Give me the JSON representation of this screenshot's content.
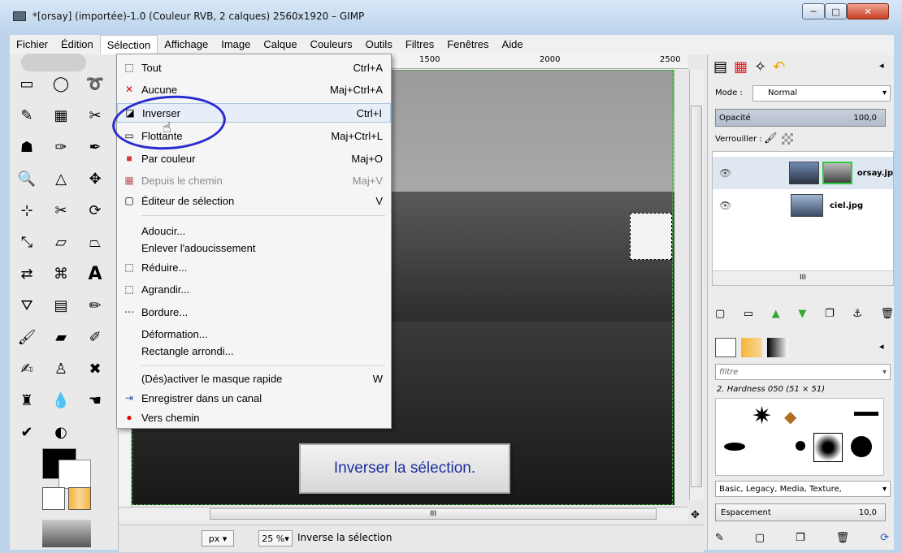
{
  "window": {
    "title": "*[orsay] (importée)-1.0 (Couleur RVB, 2 calques) 2560x1920 – GIMP",
    "buttons": {
      "minimize": "─",
      "maximize": "□",
      "close": "✕"
    }
  },
  "menubar": [
    "Fichier",
    "Édition",
    "Sélection",
    "Affichage",
    "Image",
    "Calque",
    "Couleurs",
    "Outils",
    "Filtres",
    "Fenêtres",
    "Aide"
  ],
  "dropdown": [
    {
      "label": "Tout",
      "shortcut": "Ctrl+A",
      "icon": "⬚"
    },
    {
      "label": "Aucune",
      "shortcut": "Maj+Ctrl+A",
      "icon": "✕"
    },
    {
      "label": "Inverser",
      "shortcut": "Ctrl+I",
      "icon": "◪"
    },
    {
      "label": "Flottante",
      "shortcut": "Maj+Ctrl+L",
      "icon": "▭"
    },
    {
      "label": "Par couleur",
      "shortcut": "Maj+O",
      "icon": "■"
    },
    {
      "label": "Depuis le chemin",
      "shortcut": "Maj+V",
      "icon": "▦"
    },
    {
      "label": "Éditeur de sélection",
      "shortcut": "V",
      "icon": "▢"
    },
    {
      "label": "Adoucir...",
      "shortcut": "",
      "icon": ""
    },
    {
      "label": "Enlever l'adoucissement",
      "shortcut": "",
      "icon": ""
    },
    {
      "label": "Réduire...",
      "shortcut": "",
      "icon": "⬚"
    },
    {
      "label": "Agrandir...",
      "shortcut": "",
      "icon": "⬚"
    },
    {
      "label": "Bordure...",
      "shortcut": "",
      "icon": "⋯"
    },
    {
      "label": "Déformation...",
      "shortcut": "",
      "icon": ""
    },
    {
      "label": "Rectangle arrondi...",
      "shortcut": "",
      "icon": ""
    },
    {
      "label": "(Dés)activer le masque rapide",
      "shortcut": "W",
      "icon": ""
    },
    {
      "label": "Enregistrer dans un canal",
      "shortcut": "",
      "icon": "⇥"
    },
    {
      "label": "Vers chemin",
      "shortcut": "",
      "icon": "●"
    }
  ],
  "ruler": {
    "t1500": "1500",
    "t2000": "2000",
    "t2500": "2500"
  },
  "hint": "Inverser la sélection.",
  "status": {
    "unit": "px",
    "zoom": "25 %",
    "message": "Inverse la sélection"
  },
  "layers_panel": {
    "mode_label": "Mode :",
    "mode_value": "Normal",
    "opacity_label": "Opacité",
    "opacity_value": "100,0",
    "lock_label": "Verrouiller :",
    "layers": [
      {
        "name": "orsay.jp"
      },
      {
        "name": "ciel.jpg"
      }
    ]
  },
  "brushes_panel": {
    "filter_placeholder": "filtre",
    "brush_name": "2. Hardness 050 (51 × 51)",
    "tags": "Basic, Legacy, Media, Texture,",
    "spacing_label": "Espacement",
    "spacing_value": "10,0"
  },
  "scroll": {
    "hthumb": "III",
    "layers_thumb": "III"
  },
  "colors": {
    "annotation": "#2a2ccf",
    "accent": "#3cb43c"
  }
}
